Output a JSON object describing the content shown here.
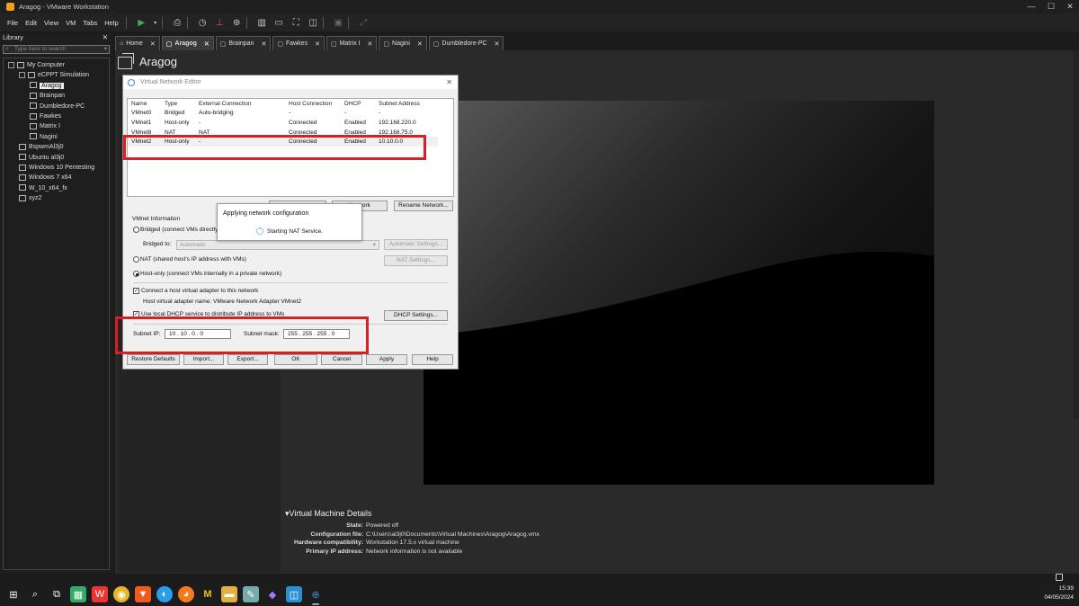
{
  "window": {
    "title": "Aragog - VMware Workstation",
    "minimize": "—",
    "maximize": "☐",
    "close": "✕"
  },
  "menu": [
    "File",
    "Edit",
    "View",
    "VM",
    "Tabs",
    "Help"
  ],
  "library": {
    "header": "Library",
    "close": "✕",
    "search_placeholder": "Type here to search",
    "tree": [
      {
        "label": "My Computer",
        "level": 0,
        "kind": "computer"
      },
      {
        "label": "eCPPT Simulation",
        "level": 1,
        "kind": "folder"
      },
      {
        "label": "Aragog",
        "level": 2,
        "kind": "vm",
        "selected": true
      },
      {
        "label": "Brainpan",
        "level": 2,
        "kind": "vm"
      },
      {
        "label": "Dumbledore-PC",
        "level": 2,
        "kind": "vm"
      },
      {
        "label": "Fawkes",
        "level": 2,
        "kind": "vm"
      },
      {
        "label": "Matrix I",
        "level": 2,
        "kind": "vm"
      },
      {
        "label": "Nagini",
        "level": 2,
        "kind": "vm"
      },
      {
        "label": "BspwmAl3j0",
        "level": 1,
        "kind": "vm"
      },
      {
        "label": "Ubuntu al3j0",
        "level": 1,
        "kind": "vm"
      },
      {
        "label": "Windows 10 Pentesting",
        "level": 1,
        "kind": "vm"
      },
      {
        "label": "Windows 7 x64",
        "level": 1,
        "kind": "vm"
      },
      {
        "label": "W_10_x64_fx",
        "level": 1,
        "kind": "vm"
      },
      {
        "label": "xyz2",
        "level": 1,
        "kind": "vm"
      }
    ]
  },
  "tabs": [
    {
      "label": "Home",
      "active": false
    },
    {
      "label": "Aragog",
      "active": true
    },
    {
      "label": "Brainpan",
      "active": false
    },
    {
      "label": "Fawkes",
      "active": false
    },
    {
      "label": "Matrix I",
      "active": false
    },
    {
      "label": "Nagini",
      "active": false
    },
    {
      "label": "Dumbledore-PC",
      "active": false
    }
  ],
  "vm_title": "Aragog",
  "details": {
    "header": "Virtual Machine Details",
    "rows": [
      {
        "k": "State:",
        "v": "Powered off"
      },
      {
        "k": "Configuration file:",
        "v": "C:\\Users\\al3j0\\Documents\\Virtual Machines\\Aragog\\Aragog.vmx"
      },
      {
        "k": "Hardware compatibility:",
        "v": "Workstation 17.5.x virtual machine"
      },
      {
        "k": "Primary IP address:",
        "v": "Network information is not available"
      }
    ]
  },
  "dialog": {
    "title": "Virtual Network Editor",
    "columns": [
      "Name",
      "Type",
      "External Connection",
      "Host Connection",
      "DHCP",
      "Subnet Address"
    ],
    "rows": [
      [
        "VMnet0",
        "Bridged",
        "Auto-bridging",
        "-",
        "-",
        "-"
      ],
      [
        "VMnet1",
        "Host-only",
        "-",
        "Connected",
        "Enabled",
        "192.168.220.0"
      ],
      [
        "VMnet8",
        "NAT",
        "NAT",
        "Connected",
        "Enabled",
        "192.168.75.0"
      ],
      [
        "VMnet2",
        "Host-only",
        "-",
        "Connected",
        "Enabled",
        "10.10.0.0"
      ]
    ],
    "selected_row": 3,
    "network_btn_partial": "Network",
    "rename_btn": "Rename Network...",
    "vmnet_info": "VMnet Information",
    "bridged": "Bridged (connect VMs directly to the external network)",
    "bridged_to": "Bridged to:",
    "bridged_value": "Automatic",
    "auto_settings": "Automatic Settings...",
    "nat": "NAT (shared host's IP address with VMs)",
    "nat_settings": "NAT Settings...",
    "hostonly": "Host-only (connect VMs internally in a private network)",
    "connect_adapter": "Connect a host virtual adapter to this network",
    "adapter_name": "Host virtual adapter name: VMware Network Adapter VMnet2",
    "use_dhcp": "Use local DHCP service to distribute IP address to VMs",
    "dhcp_settings": "DHCP Settings...",
    "subnet_ip_label": "Subnet IP:",
    "subnet_ip": "10 . 10 . 0 . 0",
    "subnet_mask_label": "Subnet mask:",
    "subnet_mask": "255 . 255 . 255 . 0",
    "buttons": [
      "Restore Defaults",
      "Import...",
      "Export...",
      "OK",
      "Cancel",
      "Apply",
      "Help"
    ]
  },
  "applying": {
    "title": "Applying network configuration",
    "status": "Starting NAT Service."
  },
  "clock": {
    "time": "15:39",
    "date": "04/05/2024"
  },
  "colors": {
    "highlight": "#d81f26",
    "accent": "#3a8fd0"
  }
}
